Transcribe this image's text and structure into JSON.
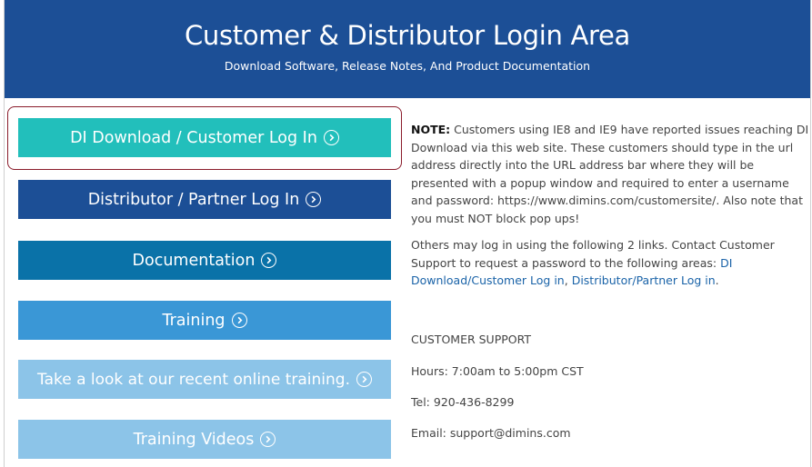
{
  "header": {
    "title": "Customer & Distributor Login Area",
    "subtitle": "Download Software, Release Notes, And Product Documentation"
  },
  "buttons": [
    {
      "label": "DI Download / Customer Log In",
      "color": "#22bfbb"
    },
    {
      "label": "Distributor / Partner Log In",
      "color": "#1c4f96"
    },
    {
      "label": "Documentation",
      "color": "#0a72a8"
    },
    {
      "label": "Training",
      "color": "#3a97d6"
    },
    {
      "label": "Take a look at our recent online training.",
      "color": "#8cc4e8"
    },
    {
      "label": "Training Videos",
      "color": "#8cc4e8"
    }
  ],
  "note": {
    "label": "NOTE:",
    "text": " Customers using IE8 and IE9 have reported issues reaching DI Download via this web site. These customers should type in the url address directly into the URL address bar where they will be presented with a popup window and required to enter a username and password: https://www.dimins.com/customersite/. Also note that you must NOT block pop ups!"
  },
  "others": {
    "text": "Others may log in using the following 2 links. Contact Customer Support to request a password to the following areas: ",
    "link1": "DI Download/Customer Log in",
    "sep": ", ",
    "link2": "Distributor/Partner Log in",
    "end": "."
  },
  "support": {
    "heading": "CUSTOMER SUPPORT",
    "hours": "Hours: 7:00am to 5:00pm CST",
    "tel": "Tel: 920-436-8299",
    "email": "Email: support@dimins.com"
  }
}
